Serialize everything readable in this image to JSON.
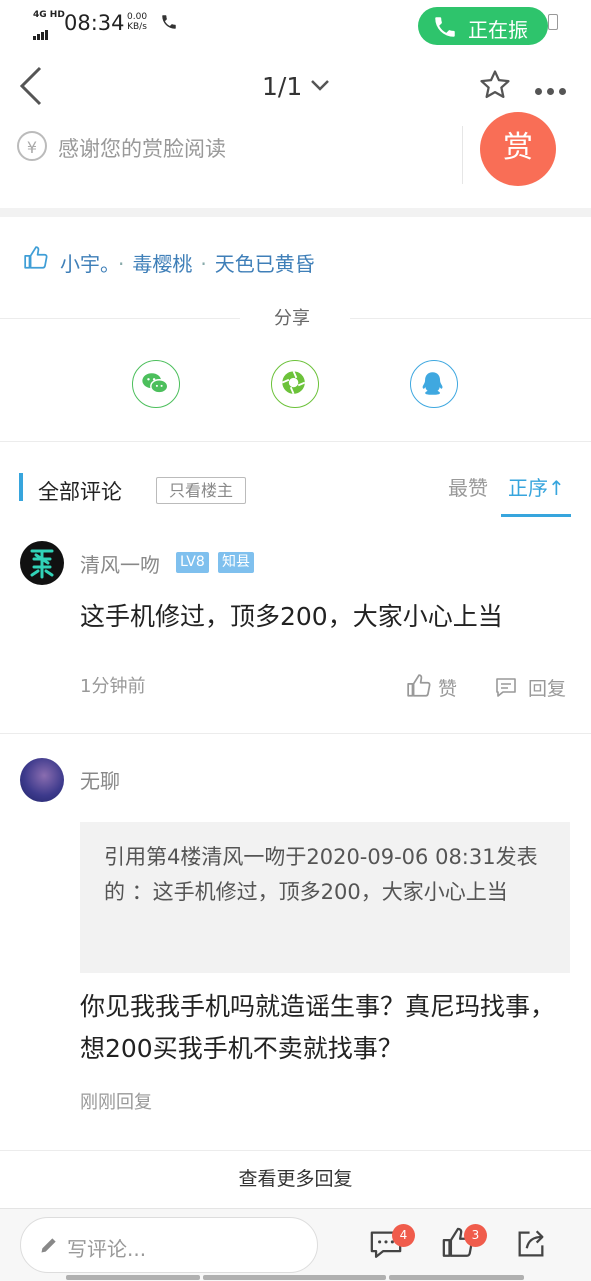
{
  "status_bar": {
    "network": "4G HD",
    "time": "08:34",
    "speed_value": "0.00",
    "speed_unit": "KB/s",
    "call_label": "正在振"
  },
  "nav": {
    "page_indicator": "1/1"
  },
  "reward": {
    "currency_symbol": "¥",
    "prompt": "感谢您的赏脸阅读",
    "button_label": "赏"
  },
  "likes": {
    "users": [
      "小宇。",
      "毒樱桃",
      "天色已黄昏"
    ],
    "separator": "·"
  },
  "share": {
    "title": "分享",
    "targets": [
      "wechat",
      "moments",
      "qq"
    ]
  },
  "comments_header": {
    "title": "全部评论",
    "owner_only": "只看楼主",
    "sort_hot": "最赞",
    "sort_order": "正序↑"
  },
  "comments": [
    {
      "user": "清风一吻",
      "level": "LV8",
      "rank": "知县",
      "text": "这手机修过，顶多200，大家小心上当",
      "time": "1分钟前",
      "like_label": "赞",
      "reply_label": "回复"
    },
    {
      "user": "无聊",
      "quote": "引用第4楼清风一吻于2020-09-06 08:31发表的 ：这手机修过，顶多200，大家小心上当",
      "text": "你见我我手机吗就造谣生事？真尼玛找事，想200买我手机不卖就找事？",
      "time": "刚刚回复"
    }
  ],
  "more_replies": "查看更多回复",
  "bottom": {
    "input_placeholder": "写评论...",
    "comment_count": "4",
    "like_count": "3"
  },
  "colors": {
    "accent_blue": "#37a5dd",
    "reward_orange": "#f96e56",
    "call_green": "#2ec46c",
    "badge_red": "#f05c4c"
  }
}
